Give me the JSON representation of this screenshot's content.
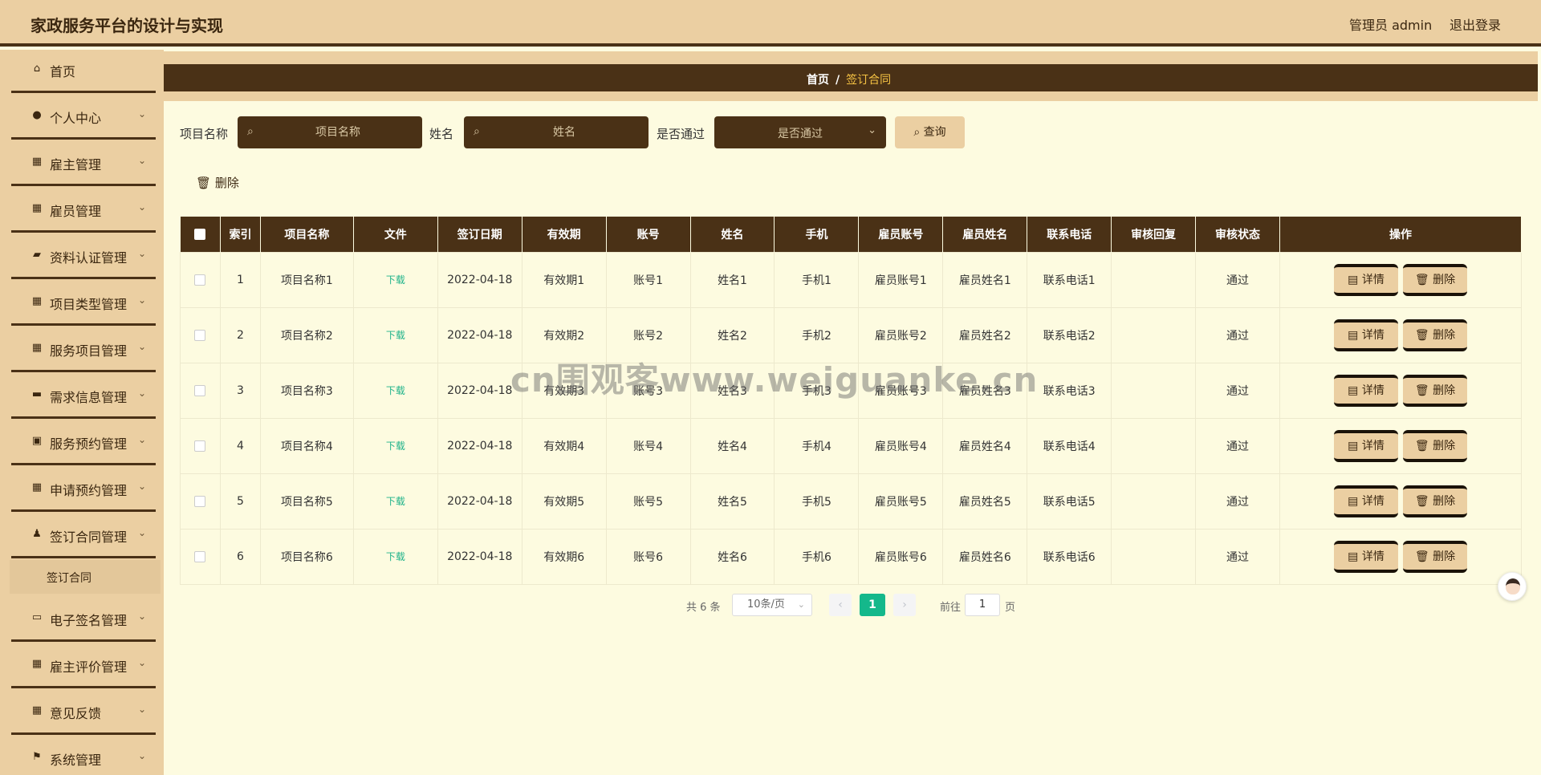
{
  "header": {
    "title": "家政服务平台的设计与实现",
    "user": "管理员 admin",
    "logout": "退出登录"
  },
  "sidebar": {
    "home": "首页",
    "items": [
      {
        "label": "个人中心",
        "icon": "user-icon"
      },
      {
        "label": "雇主管理",
        "icon": "grid-icon"
      },
      {
        "label": "雇员管理",
        "icon": "grid-icon"
      },
      {
        "label": "资料认证管理",
        "icon": "briefcase-icon"
      },
      {
        "label": "项目类型管理",
        "icon": "grid-icon"
      },
      {
        "label": "服务项目管理",
        "icon": "grid-icon"
      },
      {
        "label": "需求信息管理",
        "icon": "monitor-icon"
      },
      {
        "label": "服务预约管理",
        "icon": "clipboard-icon"
      },
      {
        "label": "申请预约管理",
        "icon": "grid-icon"
      },
      {
        "label": "签订合同管理",
        "icon": "user-stamp-icon"
      }
    ],
    "sub_item": "签订合同",
    "items2": [
      {
        "label": "电子签名管理",
        "icon": "chat-icon"
      },
      {
        "label": "雇主评价管理",
        "icon": "grid-icon"
      },
      {
        "label": "意见反馈",
        "icon": "grid-icon"
      },
      {
        "label": "系统管理",
        "icon": "flag-icon"
      }
    ]
  },
  "breadcrumb": {
    "home": "首页",
    "sep": "/",
    "current": "签订合同"
  },
  "search": {
    "name_label": "项目名称",
    "name_placeholder": "项目名称",
    "person_label": "姓名",
    "person_placeholder": "姓名",
    "pass_label": "是否通过",
    "pass_placeholder": "是否通过",
    "query": "查询"
  },
  "toolbar": {
    "delete": "删除"
  },
  "table": {
    "headers": [
      "索引",
      "项目名称",
      "文件",
      "签订日期",
      "有效期",
      "账号",
      "姓名",
      "手机",
      "雇员账号",
      "雇员姓名",
      "联系电话",
      "审核回复",
      "审核状态",
      "操作"
    ],
    "download_label": "下载",
    "detail_label": "详情",
    "delete_label": "删除",
    "rows": [
      {
        "index": "1",
        "project": "项目名称1",
        "date": "2022-04-18",
        "valid": "有效期1",
        "account": "账号1",
        "name": "姓名1",
        "phone": "手机1",
        "emp_account": "雇员账号1",
        "emp_name": "雇员姓名1",
        "contact": "联系电话1",
        "reply": "",
        "status": "通过"
      },
      {
        "index": "2",
        "project": "项目名称2",
        "date": "2022-04-18",
        "valid": "有效期2",
        "account": "账号2",
        "name": "姓名2",
        "phone": "手机2",
        "emp_account": "雇员账号2",
        "emp_name": "雇员姓名2",
        "contact": "联系电话2",
        "reply": "",
        "status": "通过"
      },
      {
        "index": "3",
        "project": "项目名称3",
        "date": "2022-04-18",
        "valid": "有效期3",
        "account": "账号3",
        "name": "姓名3",
        "phone": "手机3",
        "emp_account": "雇员账号3",
        "emp_name": "雇员姓名3",
        "contact": "联系电话3",
        "reply": "",
        "status": "通过"
      },
      {
        "index": "4",
        "project": "项目名称4",
        "date": "2022-04-18",
        "valid": "有效期4",
        "account": "账号4",
        "name": "姓名4",
        "phone": "手机4",
        "emp_account": "雇员账号4",
        "emp_name": "雇员姓名4",
        "contact": "联系电话4",
        "reply": "",
        "status": "通过"
      },
      {
        "index": "5",
        "project": "项目名称5",
        "date": "2022-04-18",
        "valid": "有效期5",
        "account": "账号5",
        "name": "姓名5",
        "phone": "手机5",
        "emp_account": "雇员账号5",
        "emp_name": "雇员姓名5",
        "contact": "联系电话5",
        "reply": "",
        "status": "通过"
      },
      {
        "index": "6",
        "project": "项目名称6",
        "date": "2022-04-18",
        "valid": "有效期6",
        "account": "账号6",
        "name": "姓名6",
        "phone": "手机6",
        "emp_account": "雇员账号6",
        "emp_name": "雇员姓名6",
        "contact": "联系电话6",
        "reply": "",
        "status": "通过"
      }
    ]
  },
  "pagination": {
    "total": "共 6 条",
    "page_size": "10条/页",
    "current_page": "1",
    "goto_label": "前往",
    "goto_value": "1",
    "page_suffix": "页"
  },
  "watermark": "cn围观客www.weiguanke.cn",
  "colors": {
    "header_bg": "#ebcfa2",
    "dark_brown": "#4a3116",
    "page_bg": "#fdfbe0",
    "accent_green": "#14b88b",
    "breadcrumb_current": "#f5c243"
  }
}
